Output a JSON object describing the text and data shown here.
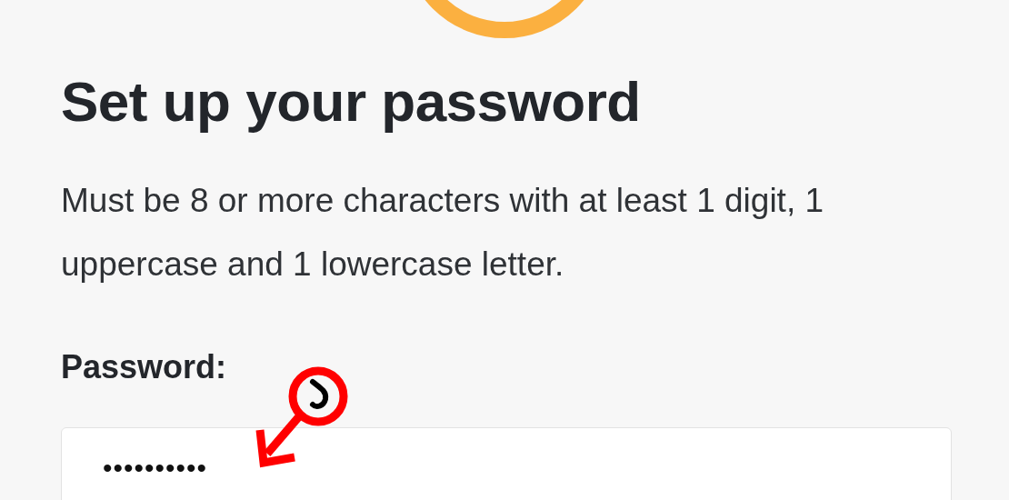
{
  "title": "Set up your password",
  "description": "Must be 8 or more characters with at least 1 digit, 1 uppercase and 1 lowercase letter.",
  "password_field": {
    "label": "Password:",
    "value": "••••••••••"
  }
}
